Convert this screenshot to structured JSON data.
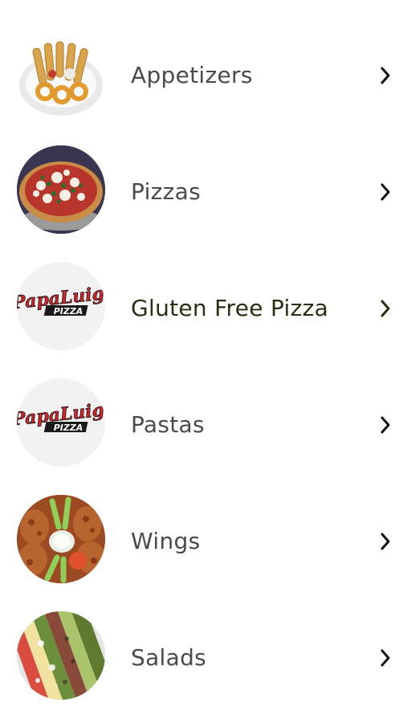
{
  "menu": {
    "items": [
      {
        "label": "Appetizers",
        "image": "appetizers-photo"
      },
      {
        "label": "Pizzas",
        "image": "pizza-photo"
      },
      {
        "label": "Gluten Free Pizza",
        "image": "papa-luigi-pizza-logo"
      },
      {
        "label": "Pastas",
        "image": "papa-luigi-pizza-logo"
      },
      {
        "label": "Wings",
        "image": "wings-photo"
      },
      {
        "label": "Salads",
        "image": "salad-photo"
      }
    ],
    "chevron_icon": "chevron-right-icon",
    "logo": {
      "script": "PapaLuigi",
      "word": "PIZZA"
    }
  },
  "colors": {
    "label": "#4a4a4a",
    "label_highlight": "#2c2e14",
    "chevron": "#111111",
    "background": "#ffffff"
  }
}
